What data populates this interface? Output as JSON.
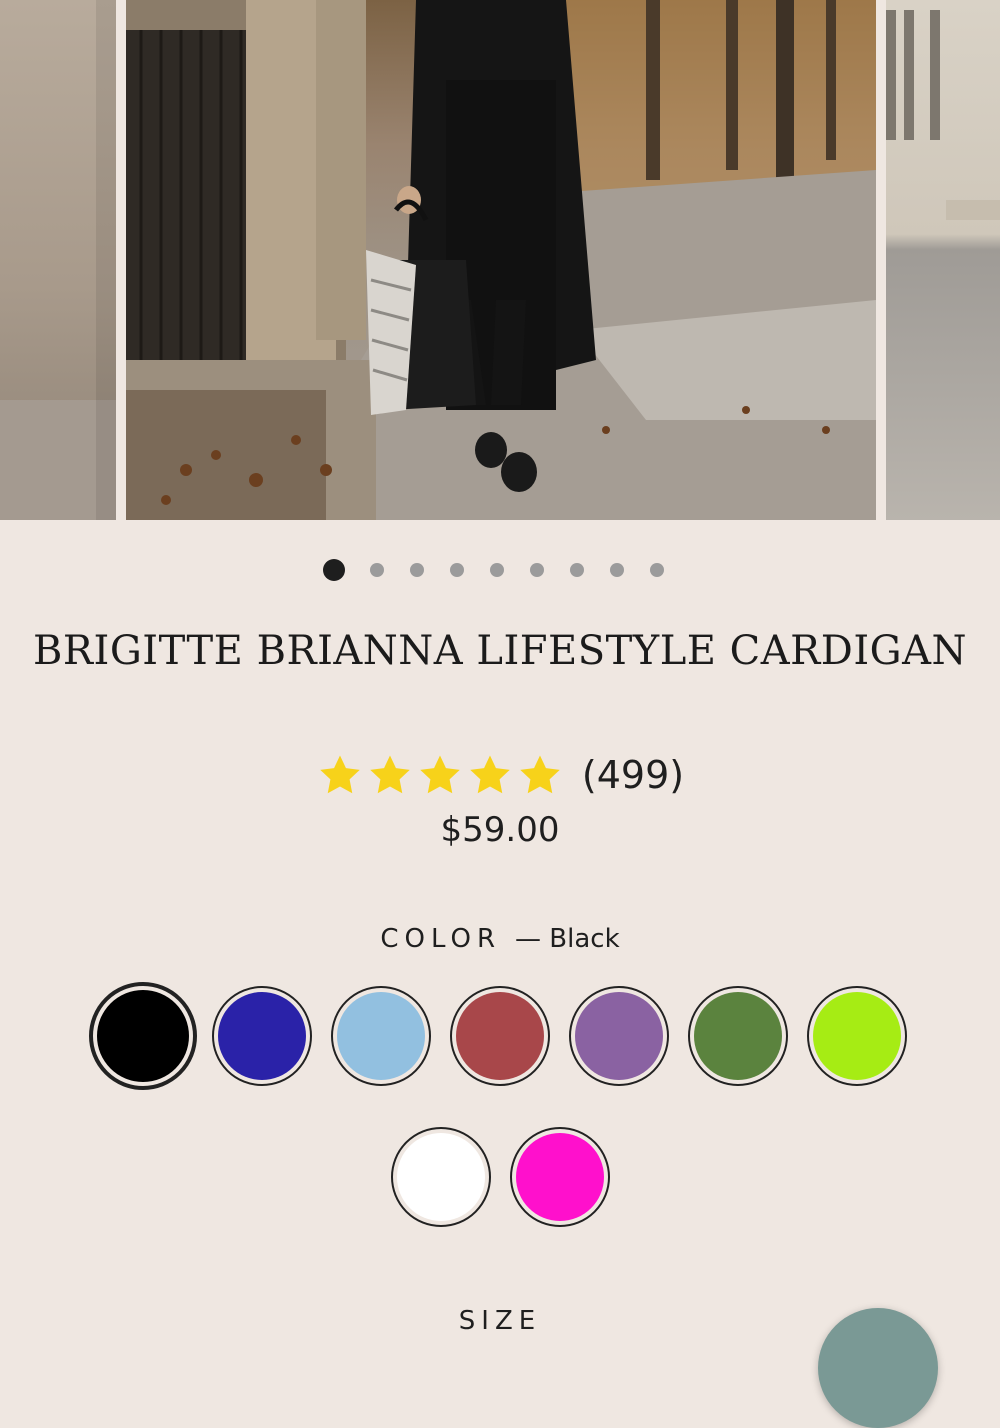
{
  "carousel": {
    "image_alt": "Woman in black cardigan walking on autumn sidewalk",
    "slide_count": 9,
    "active_index": 0
  },
  "product": {
    "title": "BRIGITTE BRIANNA LIFESTYLE CARDIGAN",
    "rating": 5,
    "review_count": "(499)",
    "price": "$59.00",
    "star_color": "#f7d21a"
  },
  "color": {
    "label": "COLOR",
    "selected_text": "— Black",
    "swatches": [
      {
        "name": "Black",
        "hex": "#000000",
        "selected": true
      },
      {
        "name": "Royal Blue",
        "hex": "#2a22a8"
      },
      {
        "name": "Light Blue",
        "hex": "#92c0e0"
      },
      {
        "name": "Brick Red",
        "hex": "#a8474a"
      },
      {
        "name": "Purple",
        "hex": "#8a62a2"
      },
      {
        "name": "Green",
        "hex": "#5b833e"
      },
      {
        "name": "Lime",
        "hex": "#a6ec14"
      },
      {
        "name": "White",
        "hex": "#ffffff"
      },
      {
        "name": "Magenta",
        "hex": "#ff10cc"
      }
    ]
  },
  "size": {
    "label": "SIZE"
  },
  "chat": {
    "icon": "chat-bubble-icon",
    "color": "#7a9995"
  }
}
